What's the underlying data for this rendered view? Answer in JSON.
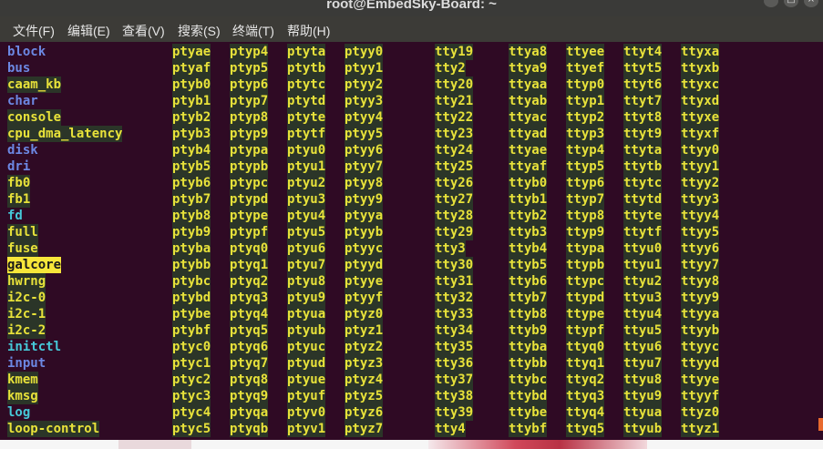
{
  "window": {
    "title": "root@EmbedSky-Board: ~",
    "min_icon": "minimize-icon",
    "max_icon": "maximize-icon",
    "close_icon": "close-icon"
  },
  "menu": [
    "文件(F)",
    "编辑(E)",
    "查看(V)",
    "搜索(S)",
    "终端(T)",
    "帮助(H)"
  ],
  "colors": {
    "terminal_bg": "#2f0a24",
    "directory": "#6c88e3",
    "char_device": "#e8e23a",
    "symlink": "#46c8d8",
    "highlight": "#f7e63a"
  },
  "columns": [
    {
      "entries": [
        {
          "text": "block",
          "type": "dir"
        },
        {
          "text": "bus",
          "type": "dir"
        },
        {
          "text": "caam_kb",
          "type": "chr"
        },
        {
          "text": "char",
          "type": "dir"
        },
        {
          "text": "console",
          "type": "chr"
        },
        {
          "text": "cpu_dma_latency",
          "type": "chr"
        },
        {
          "text": "disk",
          "type": "dir"
        },
        {
          "text": "dri",
          "type": "dir"
        },
        {
          "text": "fb0",
          "type": "chr"
        },
        {
          "text": "fb1",
          "type": "chr"
        },
        {
          "text": "fd",
          "type": "cyan"
        },
        {
          "text": "full",
          "type": "chr"
        },
        {
          "text": "fuse",
          "type": "chr"
        },
        {
          "text": "galcore",
          "type": "hl"
        },
        {
          "text": "hwrng",
          "type": "chr"
        },
        {
          "text": "i2c-0",
          "type": "chr"
        },
        {
          "text": "i2c-1",
          "type": "chr"
        },
        {
          "text": "i2c-2",
          "type": "chr"
        },
        {
          "text": "initctl",
          "type": "cyan"
        },
        {
          "text": "input",
          "type": "dir"
        },
        {
          "text": "kmem",
          "type": "chr"
        },
        {
          "text": "kmsg",
          "type": "chr"
        },
        {
          "text": "log",
          "type": "cyan"
        },
        {
          "text": "loop-control",
          "type": "chr"
        }
      ]
    },
    {
      "entries": [
        "ptyae",
        "ptyaf",
        "ptyb0",
        "ptyb1",
        "ptyb2",
        "ptyb3",
        "ptyb4",
        "ptyb5",
        "ptyb6",
        "ptyb7",
        "ptyb8",
        "ptyb9",
        "ptyba",
        "ptybb",
        "ptybc",
        "ptybd",
        "ptybe",
        "ptybf",
        "ptyc0",
        "ptyc1",
        "ptyc2",
        "ptyc3",
        "ptyc4",
        "ptyc5"
      ]
    },
    {
      "entries": [
        "ptyp4",
        "ptyp5",
        "ptyp6",
        "ptyp7",
        "ptyp8",
        "ptyp9",
        "ptypa",
        "ptypb",
        "ptypc",
        "ptypd",
        "ptype",
        "ptypf",
        "ptyq0",
        "ptyq1",
        "ptyq2",
        "ptyq3",
        "ptyq4",
        "ptyq5",
        "ptyq6",
        "ptyq7",
        "ptyq8",
        "ptyq9",
        "ptyqa",
        "ptyqb"
      ]
    },
    {
      "entries": [
        "ptyta",
        "ptytb",
        "ptytc",
        "ptytd",
        "ptyte",
        "ptytf",
        "ptyu0",
        "ptyu1",
        "ptyu2",
        "ptyu3",
        "ptyu4",
        "ptyu5",
        "ptyu6",
        "ptyu7",
        "ptyu8",
        "ptyu9",
        "ptyua",
        "ptyub",
        "ptyuc",
        "ptyud",
        "ptyue",
        "ptyuf",
        "ptyv0",
        "ptyv1"
      ]
    },
    {
      "entries": [
        "ptyy0",
        "ptyy1",
        "ptyy2",
        "ptyy3",
        "ptyy4",
        "ptyy5",
        "ptyy6",
        "ptyy7",
        "ptyy8",
        "ptyy9",
        "ptyya",
        "ptyyb",
        "ptyyc",
        "ptyyd",
        "ptyye",
        "ptyyf",
        "ptyz0",
        "ptyz1",
        "ptyz2",
        "ptyz3",
        "ptyz4",
        "ptyz5",
        "ptyz6",
        "ptyz7"
      ]
    },
    {
      "entries": [
        "tty19",
        "tty2",
        "tty20",
        "tty21",
        "tty22",
        "tty23",
        "tty24",
        "tty25",
        "tty26",
        "tty27",
        "tty28",
        "tty29",
        "tty3",
        "tty30",
        "tty31",
        "tty32",
        "tty33",
        "tty34",
        "tty35",
        "tty36",
        "tty37",
        "tty38",
        "tty39",
        "tty4"
      ]
    },
    {
      "entries": [
        "ttya8",
        "ttya9",
        "ttyaa",
        "ttyab",
        "ttyac",
        "ttyad",
        "ttyae",
        "ttyaf",
        "ttyb0",
        "ttyb1",
        "ttyb2",
        "ttyb3",
        "ttyb4",
        "ttyb5",
        "ttyb6",
        "ttyb7",
        "ttyb8",
        "ttyb9",
        "ttyba",
        "ttybb",
        "ttybc",
        "ttybd",
        "ttybe",
        "ttybf"
      ]
    },
    {
      "entries": [
        "ttyee",
        "ttyef",
        "ttyp0",
        "ttyp1",
        "ttyp2",
        "ttyp3",
        "ttyp4",
        "ttyp5",
        "ttyp6",
        "ttyp7",
        "ttyp8",
        "ttyp9",
        "ttypa",
        "ttypb",
        "ttypc",
        "ttypd",
        "ttype",
        "ttypf",
        "ttyq0",
        "ttyq1",
        "ttyq2",
        "ttyq3",
        "ttyq4",
        "ttyq5"
      ]
    },
    {
      "entries": [
        "ttyt4",
        "ttyt5",
        "ttyt6",
        "ttyt7",
        "ttyt8",
        "ttyt9",
        "ttyta",
        "ttytb",
        "ttytc",
        "ttytd",
        "ttyte",
        "ttytf",
        "ttyu0",
        "ttyu1",
        "ttyu2",
        "ttyu3",
        "ttyu4",
        "ttyu5",
        "ttyu6",
        "ttyu7",
        "ttyu8",
        "ttyu9",
        "ttyua",
        "ttyub"
      ]
    },
    {
      "entries": [
        "ttyxa",
        "ttyxb",
        "ttyxc",
        "ttyxd",
        "ttyxe",
        "ttyxf",
        "ttyy0",
        "ttyy1",
        "ttyy2",
        "ttyy3",
        "ttyy4",
        "ttyy5",
        "ttyy6",
        "ttyy7",
        "ttyy8",
        "ttyy9",
        "ttyya",
        "ttyyb",
        "ttyyc",
        "ttyyd",
        "ttyye",
        "ttyyf",
        "ttyz0",
        "ttyz1"
      ]
    }
  ]
}
